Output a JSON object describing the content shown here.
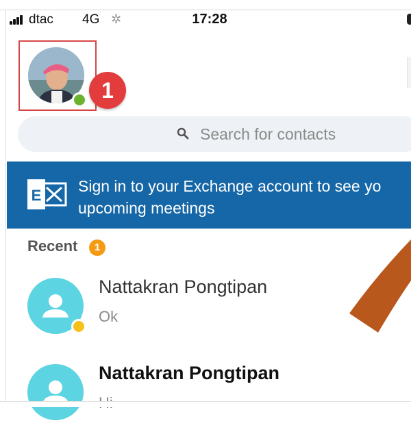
{
  "status_bar": {
    "carrier": "dtac",
    "network": "4G",
    "time": "17:28"
  },
  "profile": {
    "presence": "online",
    "step_number": "1"
  },
  "search": {
    "placeholder": "Search for contacts"
  },
  "banner": {
    "text": "Sign in to your Exchange account to see yo\nupcoming meetings",
    "icon_letter": "E"
  },
  "recent": {
    "label": "Recent",
    "count": "1",
    "contacts": [
      {
        "name": "Nattakran Pongtipan",
        "message": "Ok",
        "unread": false
      },
      {
        "name": "Nattakran Pongtipan",
        "message": "Hi",
        "unread": true
      }
    ]
  },
  "colors": {
    "banner_blue": "#1667a7",
    "badge_red": "#e23c3c",
    "contact_avatar": "#5dd4e1",
    "presence_green": "#6ab42d",
    "recent_badge": "#f59a14",
    "arrow_orange": "#b8581d"
  },
  "icons": {
    "search": "search-icon",
    "exchange": "exchange-icon",
    "contact": "person-icon"
  }
}
